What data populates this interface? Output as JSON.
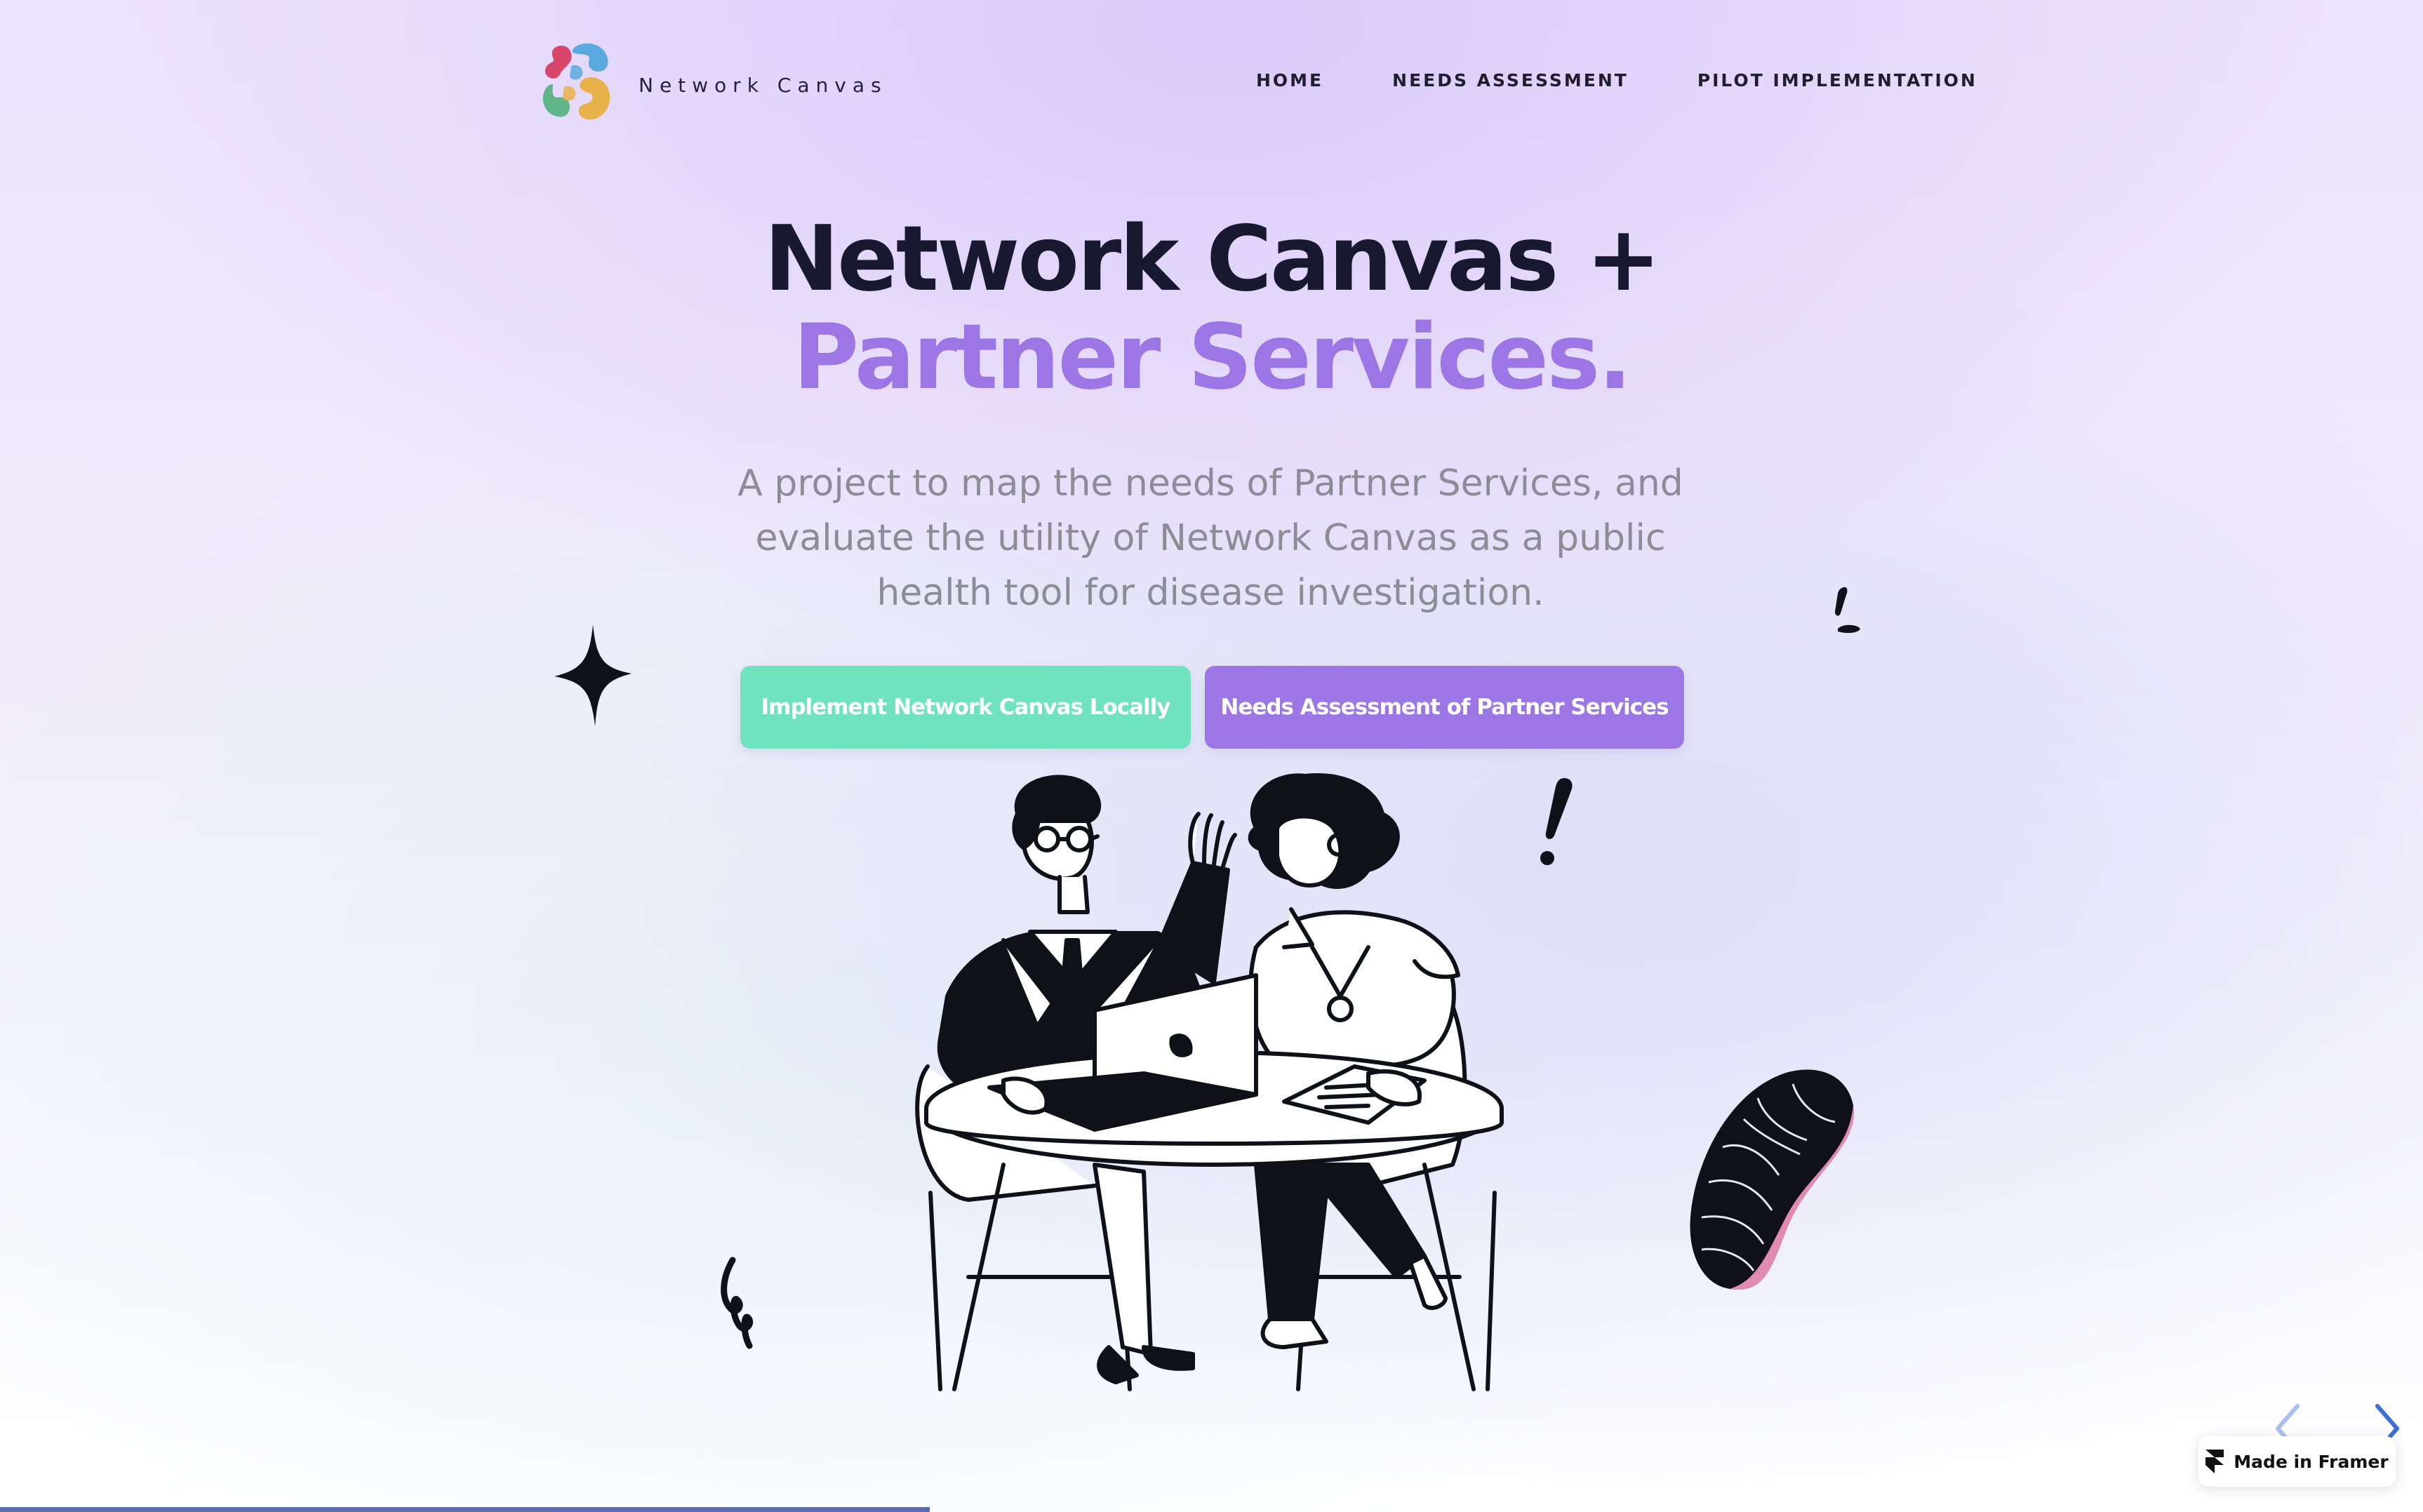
{
  "brand": {
    "name": "Network Canvas",
    "logo_colors": [
      "#d8456b",
      "#5aa9e0",
      "#5fb58a",
      "#e8b24a"
    ]
  },
  "nav": {
    "items": [
      {
        "label": "HOME"
      },
      {
        "label": "NEEDS ASSESSMENT"
      },
      {
        "label": "PILOT IMPLEMENTATION"
      }
    ]
  },
  "hero": {
    "title_line1": "Network Canvas +",
    "title_line2": "Partner Services.",
    "subtitle": "A project to map the needs of Partner Services, and evaluate the utility of Network Canvas as a public health tool for disease investigation.",
    "primary_button": "Implement Network Canvas Locally",
    "secondary_button": "Needs Assessment of Partner Services"
  },
  "colors": {
    "accent_purple": "#9d76e6",
    "accent_green": "#6ee3bd",
    "title_dark": "#181830",
    "subtitle_gray": "#8d8c96",
    "deco_pink": "#e08ab4"
  },
  "icons": [
    "sparkle-icon",
    "exclamation-icon",
    "squiggle-icon",
    "leaf-icon",
    "framer-logo-icon",
    "chevron-left-icon",
    "chevron-right-icon"
  ],
  "framer_badge": {
    "label": "Made in Framer"
  }
}
